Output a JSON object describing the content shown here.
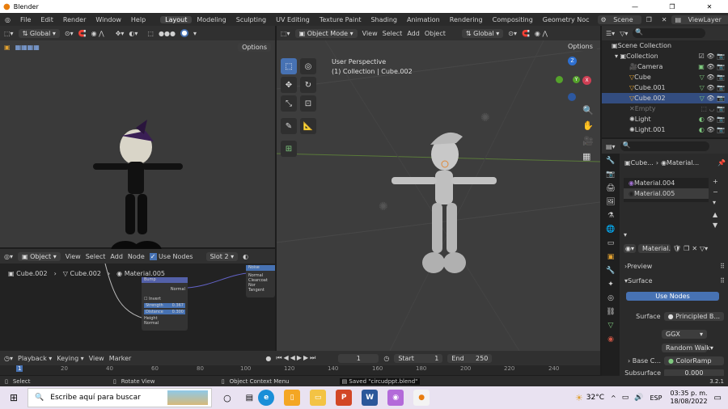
{
  "window": {
    "title": "Blender",
    "controls": [
      "—",
      "❐",
      "✕"
    ]
  },
  "menu": {
    "items": [
      "File",
      "Edit",
      "Render",
      "Window",
      "Help"
    ]
  },
  "workspaces": [
    "Layout",
    "Modeling",
    "Sculpting",
    "UV Editing",
    "Texture Paint",
    "Shading",
    "Animation",
    "Rendering",
    "Compositing",
    "Geometry Noc"
  ],
  "scene": "Scene",
  "viewlayer": "ViewLayer",
  "left_vp": {
    "orientation": "Global",
    "options": "Options"
  },
  "main_vp": {
    "mode": "Object Mode",
    "menus": [
      "View",
      "Select",
      "Add",
      "Object"
    ],
    "orientation": "Global",
    "options": "Options",
    "info_line1": "User Perspective",
    "info_line2": "(1) Collection | Cube.002"
  },
  "gizmo": {
    "x": "X",
    "y": "Y",
    "z": "Z"
  },
  "node_editor": {
    "mode": "Object",
    "menus": [
      "View",
      "Select",
      "Add",
      "Node"
    ],
    "use_nodes": "Use Nodes",
    "slot": "Slot 2",
    "crumbs": [
      "Cube.002",
      "Cube.002",
      "Material.005"
    ],
    "bump": {
      "title": "Bump",
      "out": "Normal",
      "invert": "Invert",
      "strength_label": "Strength",
      "strength_value": "0.367",
      "distance_label": "Distance",
      "distance_value": "0.300",
      "height": "Height",
      "normal": "Normal"
    },
    "bsdf": {
      "title": "Noise",
      "rows": [
        "Normal",
        "Clearcoat Nor",
        "Tangent"
      ]
    }
  },
  "timeline": {
    "playback": "Playback",
    "keying": "Keying",
    "view": "View",
    "marker": "Marker",
    "frame": "1",
    "start_label": "Start",
    "start": "1",
    "end_label": "End",
    "end": "250",
    "ticks": [
      "1",
      "20",
      "40",
      "60",
      "80",
      "100",
      "120",
      "140",
      "160",
      "180",
      "200",
      "220",
      "240"
    ]
  },
  "status": {
    "select": "Select",
    "rotate": "Rotate View",
    "context": "Object Context Menu",
    "saved": "Saved \"circudppt.blend\"",
    "version": "3.2.1"
  },
  "outliner": {
    "root": "Scene Collection",
    "collection": "Collection",
    "items": [
      "Camera",
      "Cube",
      "Cube.001",
      "Cube.002",
      "Empty",
      "Light",
      "Light.001"
    ]
  },
  "props": {
    "crumb1": "Cube...",
    "crumb2": "Material...",
    "materials": [
      "Material.004",
      "Material.005"
    ],
    "mat_field": "Material...",
    "preview": "Preview",
    "surface": "Surface",
    "use_nodes": "Use Nodes",
    "surface_label": "Surface",
    "surface_value": "Principled B...",
    "ggx": "GGX",
    "rw": "Random Walk",
    "basec_label": "Base C...",
    "basec_value": "ColorRamp",
    "subs_label": "Subsurface",
    "subs_value": "0.000"
  },
  "taskbar": {
    "search": "Escribe aquí para buscar",
    "temp": "32°C",
    "lang": "ESP",
    "time": "03:35 p. m.",
    "date": "18/08/2022"
  }
}
